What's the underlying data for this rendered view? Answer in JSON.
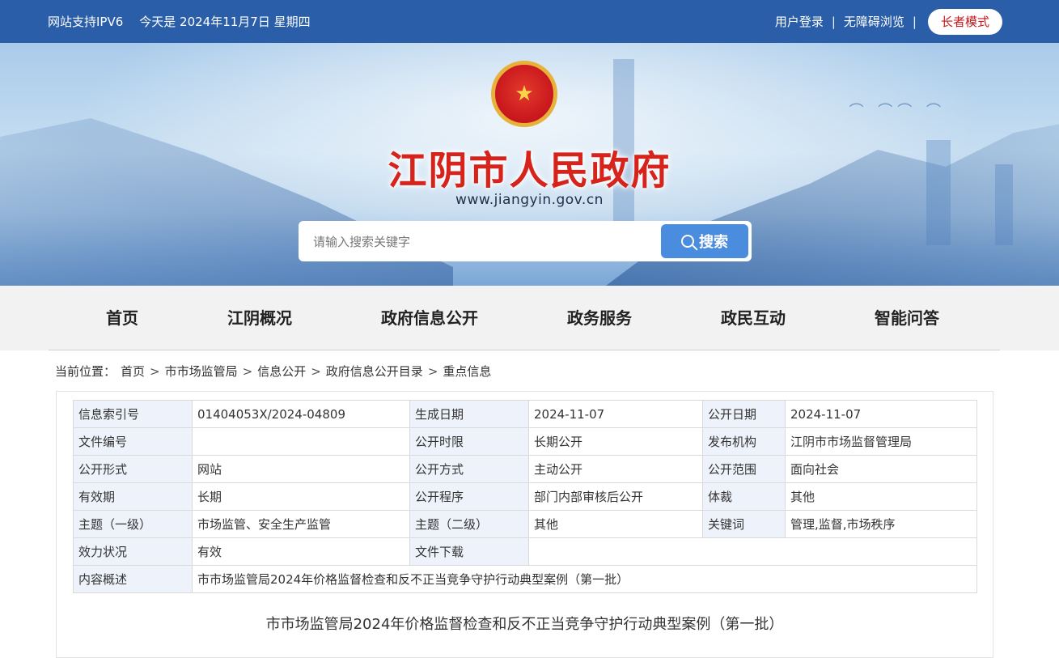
{
  "topbar": {
    "ipv6": "网站支持IPV6",
    "date": "今天是 2024年11月7日 星期四",
    "login": "用户登录",
    "sep": "|",
    "accessible": "无障碍浏览",
    "elder_mode": "长者模式"
  },
  "banner": {
    "title": "江阴市人民政府",
    "url": "www.jiangyin.gov.cn",
    "search_placeholder": "请输入搜索关键字",
    "search_button": "搜索"
  },
  "nav": [
    "首页",
    "江阴概况",
    "政府信息公开",
    "政务服务",
    "政民互动",
    "智能问答"
  ],
  "breadcrumb": {
    "label": "当前位置：",
    "items": [
      "首页",
      "市市场监管局",
      "信息公开",
      "政府信息公开目录",
      "重点信息"
    ],
    "arrow": ">"
  },
  "meta_table": [
    [
      "信息索引号",
      "01404053X/2024-04809",
      "生成日期",
      "2024-11-07",
      "公开日期",
      "2024-11-07"
    ],
    [
      "文件编号",
      "",
      "公开时限",
      "长期公开",
      "发布机构",
      "江阴市市场监督管理局"
    ],
    [
      "公开形式",
      "网站",
      "公开方式",
      "主动公开",
      "公开范围",
      "面向社会"
    ],
    [
      "有效期",
      "长期",
      "公开程序",
      "部门内部审核后公开",
      "体裁",
      "其他"
    ],
    [
      "主题（一级）",
      "市场监管、安全生产监管",
      "主题（二级）",
      "其他",
      "关键词",
      "管理,监督,市场秩序"
    ],
    [
      "效力状况",
      "有效",
      "文件下载",
      ""
    ],
    [
      "内容概述",
      "市市场监管局2024年价格监督检查和反不正当竞争守护行动典型案例（第一批）"
    ]
  ],
  "article_title": "市市场监管局2024年价格监督检查和反不正当竞争守护行动典型案例（第一批）",
  "colors": {
    "topbar": "#2a5ea8",
    "title_red": "#d6231c",
    "search_button": "#4a8cde",
    "nav_bg": "#f2f2f2",
    "table_key_bg": "#eef2fa"
  }
}
